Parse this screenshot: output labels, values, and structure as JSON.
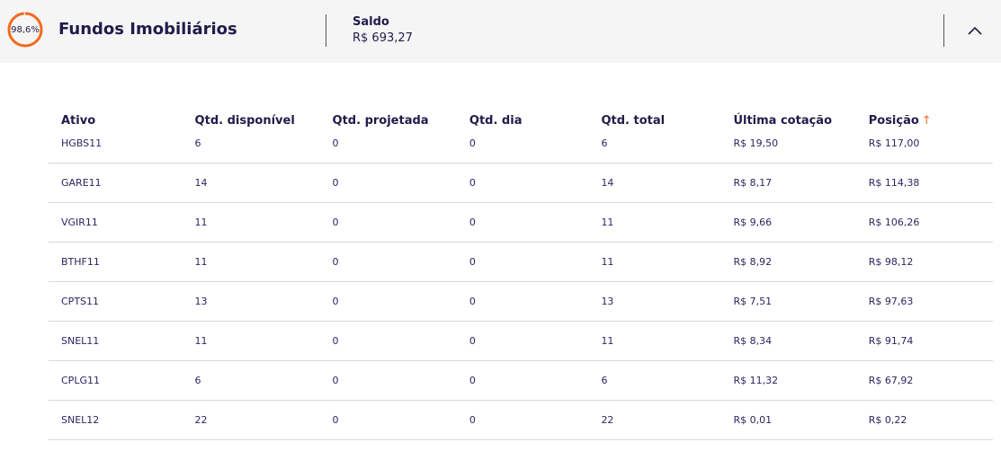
{
  "header": {
    "allocation_percent": "98,6%",
    "allocation_fraction": 0.986,
    "title": "Fundos Imobiliários",
    "balance_label": "Saldo",
    "balance_value": "R$ 693,27",
    "collapse_icon": "chevron-up-icon"
  },
  "colors": {
    "accent": "#f26b1d",
    "text": "#1f1c4a",
    "header_bg": "#f5f5f5"
  },
  "table": {
    "columns": [
      "Ativo",
      "Qtd. disponível",
      "Qtd. projetada",
      "Qtd. dia",
      "Qtd. total",
      "Última cotação",
      "Posição"
    ],
    "sort_icon": "arrow-up-icon",
    "rows": [
      [
        "HGBS11",
        "6",
        "0",
        "0",
        "6",
        "R$ 19,50",
        "R$ 117,00"
      ],
      [
        "GARE11",
        "14",
        "0",
        "0",
        "14",
        "R$ 8,17",
        "R$ 114,38"
      ],
      [
        "VGIR11",
        "11",
        "0",
        "0",
        "11",
        "R$ 9,66",
        "R$ 106,26"
      ],
      [
        "BTHF11",
        "11",
        "0",
        "0",
        "11",
        "R$ 8,92",
        "R$ 98,12"
      ],
      [
        "CPTS11",
        "13",
        "0",
        "0",
        "13",
        "R$ 7,51",
        "R$ 97,63"
      ],
      [
        "SNEL11",
        "11",
        "0",
        "0",
        "11",
        "R$ 8,34",
        "R$ 91,74"
      ],
      [
        "CPLG11",
        "6",
        "0",
        "0",
        "6",
        "R$ 11,32",
        "R$ 67,92"
      ],
      [
        "SNEL12",
        "22",
        "0",
        "0",
        "22",
        "R$ 0,01",
        "R$ 0,22"
      ]
    ]
  }
}
